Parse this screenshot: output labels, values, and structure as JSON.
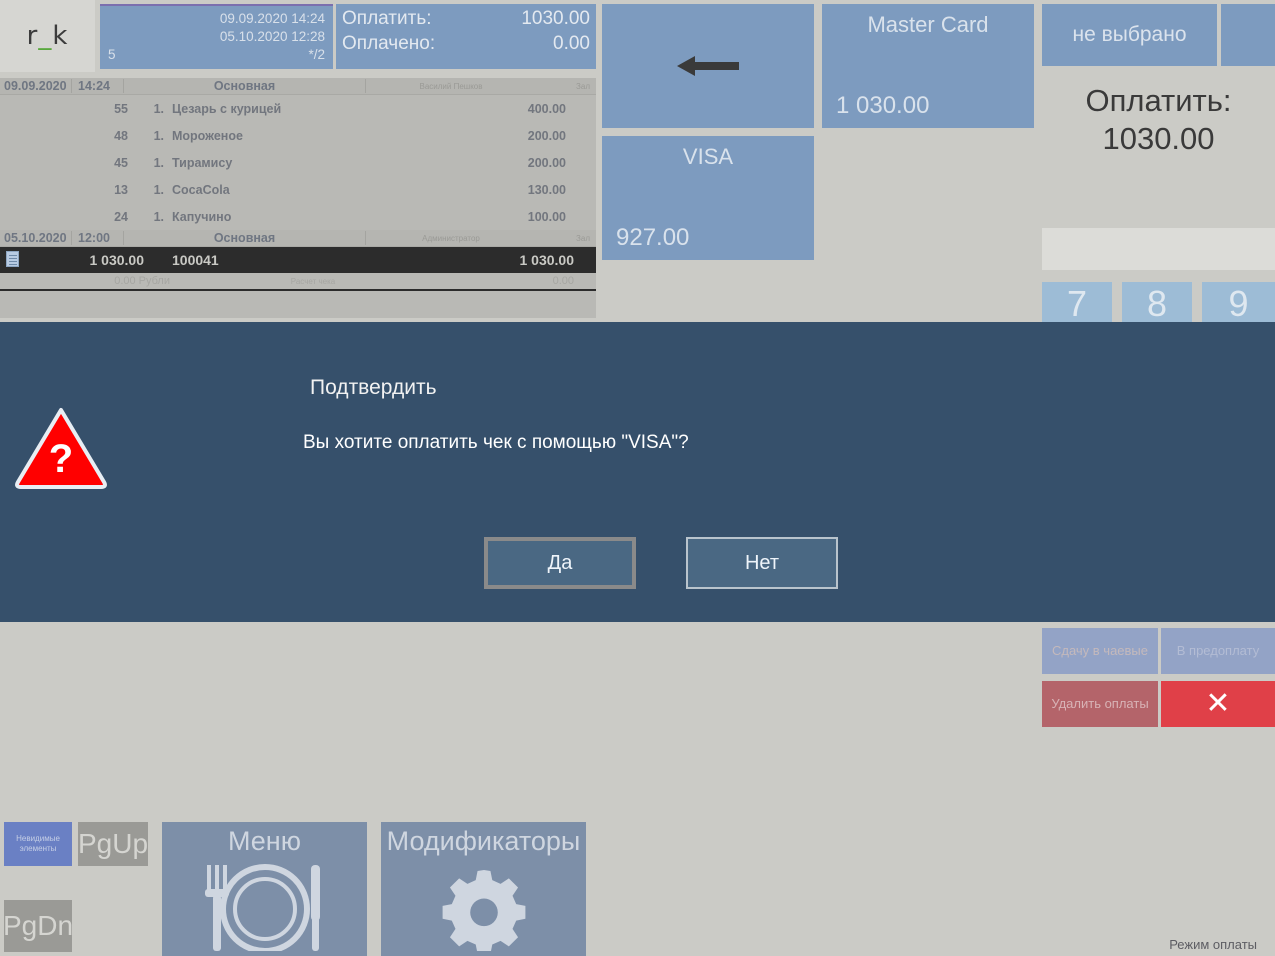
{
  "logo": {
    "prefix": "r",
    "underscore": "_",
    "suffix": "k"
  },
  "order_info": {
    "opened_at": "09.09.2020  14:24",
    "closed_at": "05.10.2020  12:28",
    "table": "5",
    "guests": "*/2"
  },
  "amounts": {
    "to_pay_label": "Оплатить:",
    "to_pay_value": "1030.00",
    "paid_label": "Оплачено:",
    "paid_value": "0.00"
  },
  "receipt": {
    "groups": [
      {
        "date": "09.09.2020",
        "time": "14:24",
        "name": "Основная",
        "user": "Василий Пешков",
        "seat": "Зал",
        "items": [
          {
            "code": "55",
            "qty": "1.",
            "name": "Цезарь с курицей",
            "sum": "400.00"
          },
          {
            "code": "48",
            "qty": "1.",
            "name": "Мороженое",
            "sum": "200.00"
          },
          {
            "code": "45",
            "qty": "1.",
            "name": "Тирамису",
            "sum": "200.00"
          },
          {
            "code": "13",
            "qty": "1.",
            "name": "CocaCola",
            "sum": "130.00"
          },
          {
            "code": "24",
            "qty": "1.",
            "name": "Капучино",
            "sum": "100.00"
          }
        ]
      },
      {
        "date": "05.10.2020",
        "time": "12:00",
        "name": "Основная",
        "user": "Администратор",
        "seat": "Зал",
        "items": []
      }
    ],
    "payment_row": {
      "amount": "1 030.00",
      "number": "100041",
      "total": "1 030.00"
    },
    "tail_row": {
      "amount": "0.00 Рубли",
      "label": "Расчет чека",
      "sum": "0.00"
    }
  },
  "tiles": {
    "back": {
      "icon": "arrow-left-icon"
    },
    "mastercard": {
      "label": "Master Card",
      "value": "1 030.00"
    },
    "visa": {
      "label": "VISA",
      "value": "927.00"
    },
    "not_selected": {
      "label": "не выбрано"
    }
  },
  "pay_panel": {
    "label": "Оплатить:",
    "value": "1030.00"
  },
  "numpad": {
    "keys": [
      "7",
      "8",
      "9"
    ],
    "value": ""
  },
  "side_buttons": {
    "tips": "Сдачу в чаевые",
    "prepay": "В предоплату",
    "delete_payments": "Удалить оплаты",
    "close": "✕"
  },
  "bottom_bar": {
    "invisible_elements": "Невидимые элементы",
    "pgup": "PgUp",
    "pgdn": "PgDn",
    "menu": "Меню",
    "modifiers": "Модификаторы"
  },
  "status": {
    "text": "Режим оплаты"
  },
  "dialog": {
    "title": "Подтвердить",
    "message": "Вы хотите оплатить чек с помощью \"VISA\"?",
    "yes": "Да",
    "no": "Нет",
    "icon": "question-warning-icon"
  },
  "colors": {
    "tile_blue": "#7d9bbf",
    "dialog_bg": "#36506b",
    "danger_red": "#e04048",
    "accent_green": "#58a83c"
  }
}
